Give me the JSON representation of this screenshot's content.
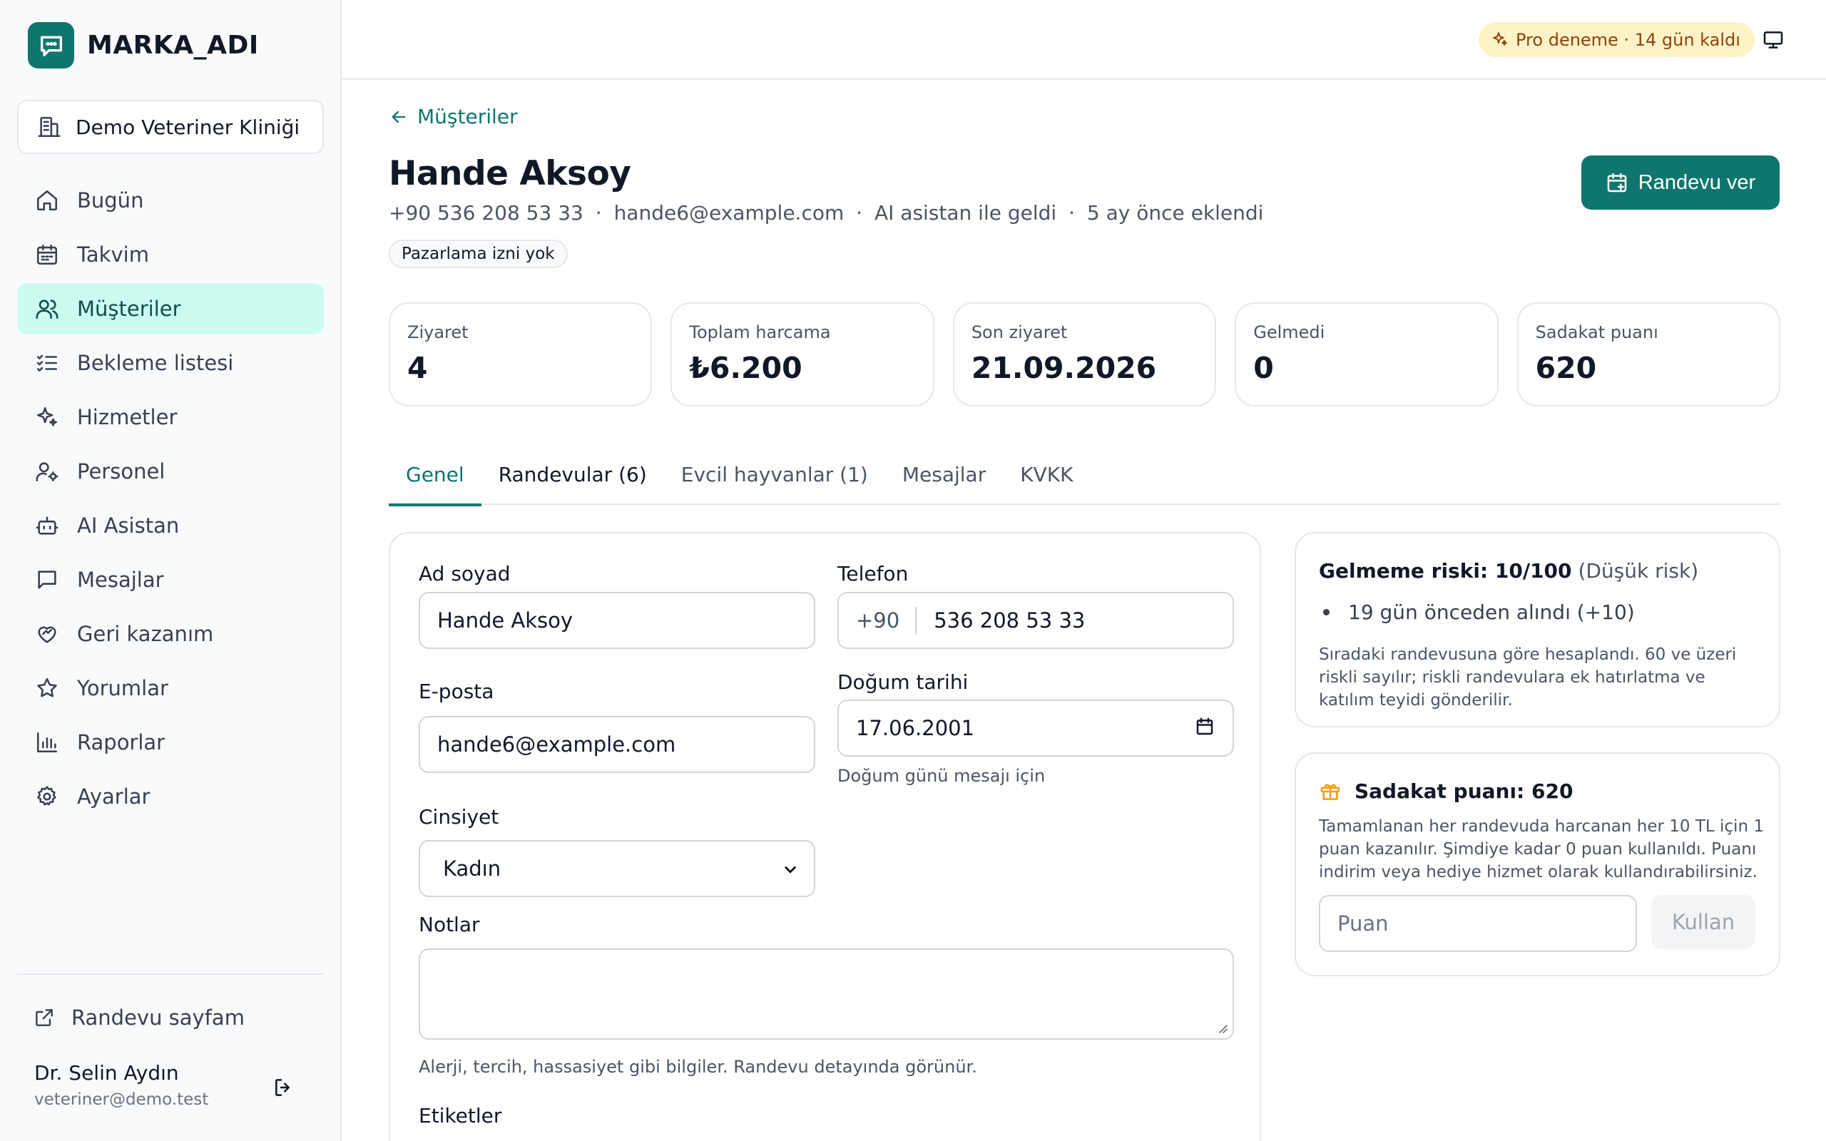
{
  "brand": {
    "name": "MARKA_ADI"
  },
  "org": {
    "name": "Demo Veteriner Kliniği"
  },
  "nav": {
    "items": [
      {
        "label": "Bugün"
      },
      {
        "label": "Takvim"
      },
      {
        "label": "Müşteriler"
      },
      {
        "label": "Bekleme listesi"
      },
      {
        "label": "Hizmetler"
      },
      {
        "label": "Personel"
      },
      {
        "label": "AI Asistan"
      },
      {
        "label": "Mesajlar"
      },
      {
        "label": "Geri kazanım"
      },
      {
        "label": "Yorumlar"
      },
      {
        "label": "Raporlar"
      },
      {
        "label": "Ayarlar"
      }
    ],
    "active": "Müşteriler"
  },
  "sidebar_footer": {
    "booking_link": "Randevu sayfam",
    "user_name": "Dr. Selin Aydın",
    "user_email": "veteriner@demo.test"
  },
  "topbar": {
    "trial_badge": "Pro deneme · 14 gün kaldı"
  },
  "customer": {
    "back_label": "Müşteriler",
    "name": "Hande Aksoy",
    "phone_display": "+90 536 208 53 33",
    "email": "hande6@example.com",
    "source": "AI asistan ile geldi",
    "added": "5 ay önce eklendi",
    "separator": "·",
    "consent_badge": "Pazarlama izni yok",
    "primary_action": "Randevu ver"
  },
  "stats": [
    {
      "label": "Ziyaret",
      "value": "4"
    },
    {
      "label": "Toplam harcama",
      "value": "₺6.200"
    },
    {
      "label": "Son ziyaret",
      "value": "21.09.2026"
    },
    {
      "label": "Gelmedi",
      "value": "0"
    },
    {
      "label": "Sadakat puanı",
      "value": "620"
    }
  ],
  "tabs": [
    {
      "label": "Genel"
    },
    {
      "label": "Randevular (6)"
    },
    {
      "label": "Evcil hayvanlar (1)"
    },
    {
      "label": "Mesajlar"
    },
    {
      "label": "KVKK"
    }
  ],
  "form": {
    "name_label": "Ad soyad",
    "name_value": "Hande Aksoy",
    "phone_label": "Telefon",
    "phone_prefix": "+90",
    "phone_value": "536 208 53 33",
    "email_label": "E-posta",
    "email_value": "hande6@example.com",
    "birth_label": "Doğum tarihi",
    "birth_value": "17.06.2001",
    "birth_hint": "Doğum günü mesajı için",
    "gender_label": "Cinsiyet",
    "gender_value": "Kadın",
    "notes_label": "Notlar",
    "notes_value": "",
    "notes_hint": "Alerji, tercih, hassasiyet gibi bilgiler. Randevu detayında görünür.",
    "tags_label": "Etiketler"
  },
  "risk": {
    "title": "Gelmeme riski: 10/100",
    "level": "(Düşük risk)",
    "bullet": "19 gün önceden alındı (+10)",
    "description": "Sıradaki randevusuna göre hesaplandı. 60 ve üzeri riskli sayılır; riskli randevulara ek hatırlatma ve katılım teyidi gönderilir."
  },
  "loyalty": {
    "title": "Sadakat puanı: 620",
    "description": "Tamamlanan her randevuda harcanan her 10 TL için 1 puan kazanılır. Şimdiye kadar 0 puan kullanıldı. Puanı indirim veya hediye hizmet olarak kullandırabilirsiniz.",
    "input_placeholder": "Puan",
    "use_button": "Kullan"
  },
  "colors": {
    "accent": "#0f766e",
    "active_nav_bg": "#ccfbf1",
    "trial_bg": "#fef3c7",
    "trial_text": "#92400e",
    "gift_icon": "#f59e0b"
  }
}
